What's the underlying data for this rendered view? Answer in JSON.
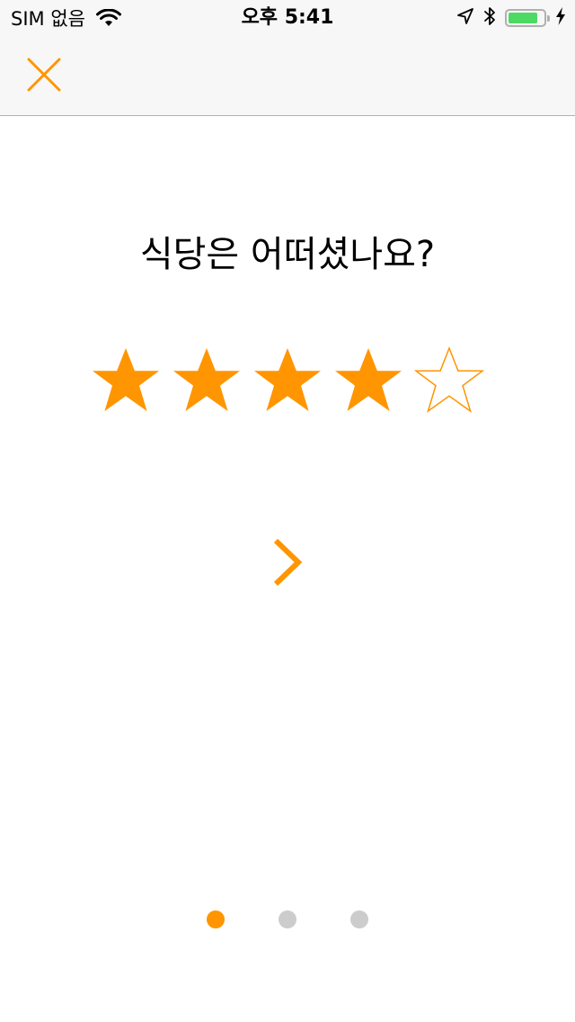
{
  "status_bar": {
    "carrier": "SIM 없음",
    "time": "오후 5:41",
    "battery_level": 0.85,
    "icons": [
      "wifi-icon",
      "location-arrow-icon",
      "bluetooth-icon",
      "battery-icon",
      "charging-bolt-icon"
    ]
  },
  "nav": {
    "close_icon": "close-icon"
  },
  "main": {
    "question": "식당은 어떠셨나요?",
    "rating": 4,
    "max_rating": 5,
    "next_icon": "chevron-right-icon"
  },
  "pager": {
    "pages": 3,
    "current": 1
  },
  "colors": {
    "accent": "#ff9500",
    "inactive_dot": "#cccccc",
    "battery_green": "#4cd964",
    "bar_background": "#f7f7f7"
  }
}
